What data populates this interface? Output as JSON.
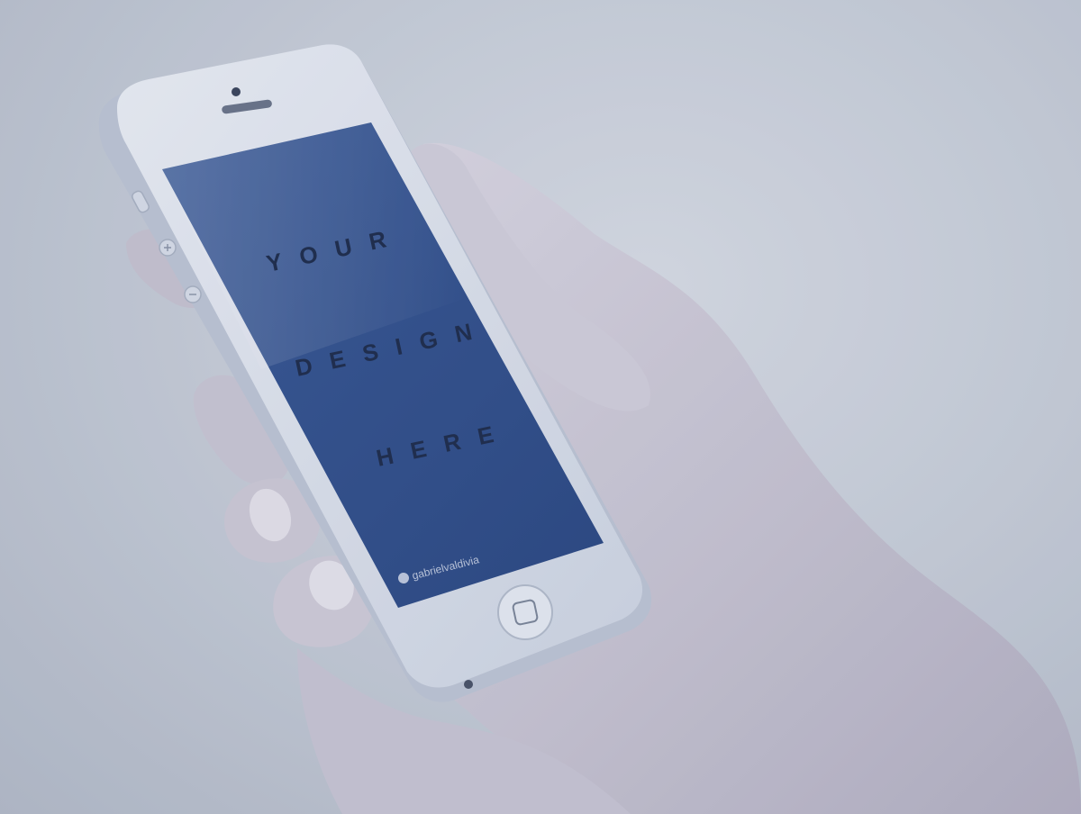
{
  "screen": {
    "line1": "YOUR",
    "line2": "DESIGN",
    "line3": "HERE",
    "watermark": "gabrielvaldivia"
  },
  "colors": {
    "screen_fill": "#2f4f8a",
    "phone_body": "#e8ecf3",
    "skin": "#d7d2dc",
    "background": "#cfd4dc"
  },
  "icons": [
    "home-button-icon",
    "front-camera-icon",
    "earpiece-icon",
    "watermark-logo-icon",
    "volume-up-icon",
    "volume-down-icon",
    "mute-switch-icon"
  ]
}
